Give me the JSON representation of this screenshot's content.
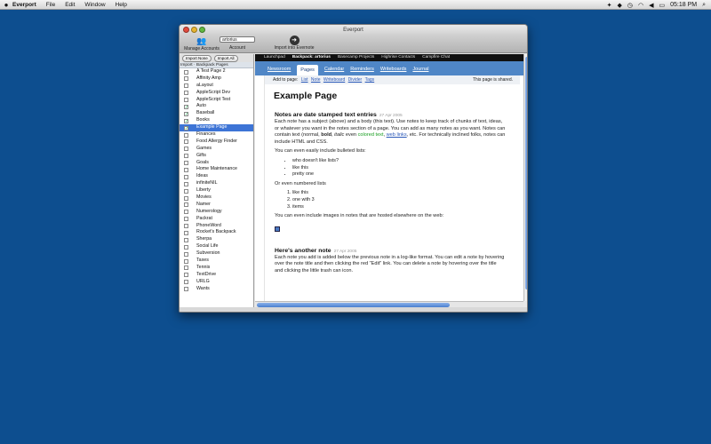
{
  "menubar": {
    "apple": "",
    "app_name": "Everport",
    "items": [
      "File",
      "Edit",
      "Window",
      "Help"
    ],
    "clock": "05:18 PM",
    "status_icons": [
      "twitter-icon",
      "dropbox-icon",
      "clock-icon",
      "wifi-icon",
      "volume-icon",
      "battery-icon",
      "search-icon"
    ]
  },
  "window": {
    "title": "Everport",
    "toolbar": {
      "manage_accounts": "Manage Accounts",
      "account_label": "Account",
      "account_value": "artorius",
      "import_label": "Import into Evernote"
    },
    "sidebar": {
      "import_none": "Import None",
      "import_all": "Import All",
      "col_import": "Import",
      "col_pages": "Backpack Pages",
      "pages": [
        {
          "label": "A Test Page 2",
          "checked": false
        },
        {
          "label": "Affinity Amp",
          "checked": false
        },
        {
          "label": "aLayout",
          "checked": false
        },
        {
          "label": "AppleScript Dev",
          "checked": false
        },
        {
          "label": "AppleScript Test",
          "checked": false
        },
        {
          "label": "Auto",
          "checked": true
        },
        {
          "label": "Baseball",
          "checked": true
        },
        {
          "label": "Books",
          "checked": true
        },
        {
          "label": "Example Page",
          "checked": true,
          "selected": true
        },
        {
          "label": "Finances",
          "checked": false
        },
        {
          "label": "Food Allergy Finder",
          "checked": false
        },
        {
          "label": "Games",
          "checked": false
        },
        {
          "label": "Gifts",
          "checked": false
        },
        {
          "label": "Goals",
          "checked": false
        },
        {
          "label": "Home Maintenance",
          "checked": false
        },
        {
          "label": "Ideas",
          "checked": false
        },
        {
          "label": "infiniteNIL",
          "checked": false
        },
        {
          "label": "Liberty",
          "checked": false
        },
        {
          "label": "Movies",
          "checked": false
        },
        {
          "label": "Namer",
          "checked": false
        },
        {
          "label": "Numerology",
          "checked": false
        },
        {
          "label": "Packrat",
          "checked": false
        },
        {
          "label": "PhoneWord",
          "checked": false
        },
        {
          "label": "Rocket's Backpack",
          "checked": false
        },
        {
          "label": "Sherpa",
          "checked": false
        },
        {
          "label": "Social Life",
          "checked": false
        },
        {
          "label": "Subversion",
          "checked": false
        },
        {
          "label": "Taxes",
          "checked": false
        },
        {
          "label": "Tennis",
          "checked": false
        },
        {
          "label": "TextDrive",
          "checked": false
        },
        {
          "label": "URLG",
          "checked": false
        },
        {
          "label": "Wants",
          "checked": false
        }
      ]
    },
    "content": {
      "breadcrumbs": [
        "Launchpad",
        "Backpack: artorius",
        "Basecamp Projects",
        "Highrise Contacts",
        "Campfire Chat"
      ],
      "current_breadcrumb_index": 1,
      "tabs": [
        "Newsroom",
        "Pages",
        "Calendar",
        "Reminders",
        "Writeboards",
        "Journal"
      ],
      "active_tab_index": 1,
      "add_to_page": "Add to page:",
      "add_links": [
        "List",
        "Note",
        "Writeboard",
        "Divider",
        "Tags"
      ],
      "shared": "This page is shared.",
      "page_title": "Example Page",
      "note1": {
        "title": "Notes are date stamped text entries",
        "date": "27 Apr 2005",
        "p1_a": "Each note has a subject (above) and a body (this text). Use notes to keep track of chunks of text, ideas, or whatever you want in the notes section of a page. You can add as many notes as you want. Notes can contain text (normal, ",
        "p1_bold": "bold",
        "p1_b": ", ",
        "p1_italic": "italic",
        "p1_c": " even ",
        "p1_colored": "colored text",
        "p1_d": ", ",
        "p1_link": "web links",
        "p1_e": ", etc. For technically inclined folks, notes can include HTML and CSS.",
        "bullets_intro": "You can even easily include bulleted lists:",
        "bullets": [
          "who doesn't like lists?",
          "like this",
          "pretty one"
        ],
        "numbered_intro": "Or even numbered lists",
        "numbered": [
          "like this",
          "one with 3",
          "items"
        ],
        "images_text": "You can even include images in notes that are hosted elsewhere on the web:"
      },
      "note2": {
        "title": "Here's another note",
        "date": "27 Apr 2005",
        "body": "Each note you add is added below the previous note in a log-like format. You can edit a note by hovering over the note title and then clicking the red \"Edit\" link. You can delete a note by hovering over the title and clicking the little trash can icon."
      }
    }
  }
}
